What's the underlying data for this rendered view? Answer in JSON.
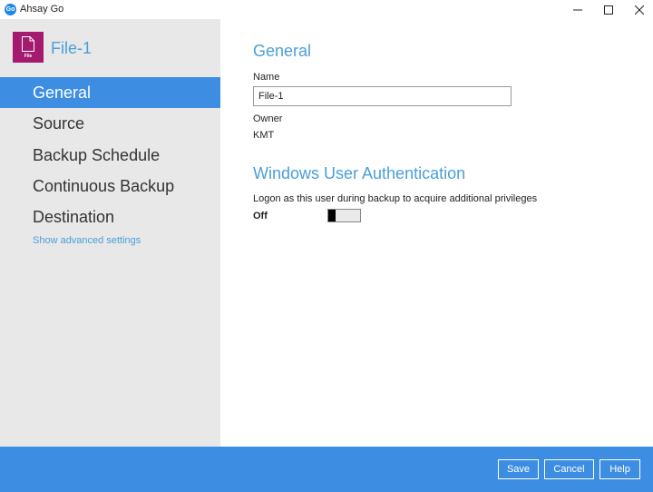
{
  "app": {
    "title": "Ahsay Go",
    "icon_text": "Go"
  },
  "window_controls": {
    "minimize": "—",
    "maximize": "☐",
    "close": "✕"
  },
  "sidebar": {
    "file_title": "File-1",
    "file_icon_caption": "File",
    "items": [
      {
        "label": "General",
        "active": true
      },
      {
        "label": "Source"
      },
      {
        "label": "Backup Schedule"
      },
      {
        "label": "Continuous Backup"
      },
      {
        "label": "Destination"
      }
    ],
    "advanced_link": "Show advanced settings"
  },
  "general": {
    "heading": "General",
    "name_label": "Name",
    "name_value": "File-1",
    "owner_label": "Owner",
    "owner_value": "KMT"
  },
  "auth": {
    "heading": "Windows User Authentication",
    "description": "Logon as this user during backup to acquire additional privileges",
    "toggle_state": "Off"
  },
  "footer": {
    "save": "Save",
    "cancel": "Cancel",
    "help": "Help"
  },
  "colors": {
    "accent": "#3d8ee3",
    "link": "#4a9fd8",
    "file_icon": "#a31a6e",
    "sidebar_bg": "#e8e8e8"
  }
}
